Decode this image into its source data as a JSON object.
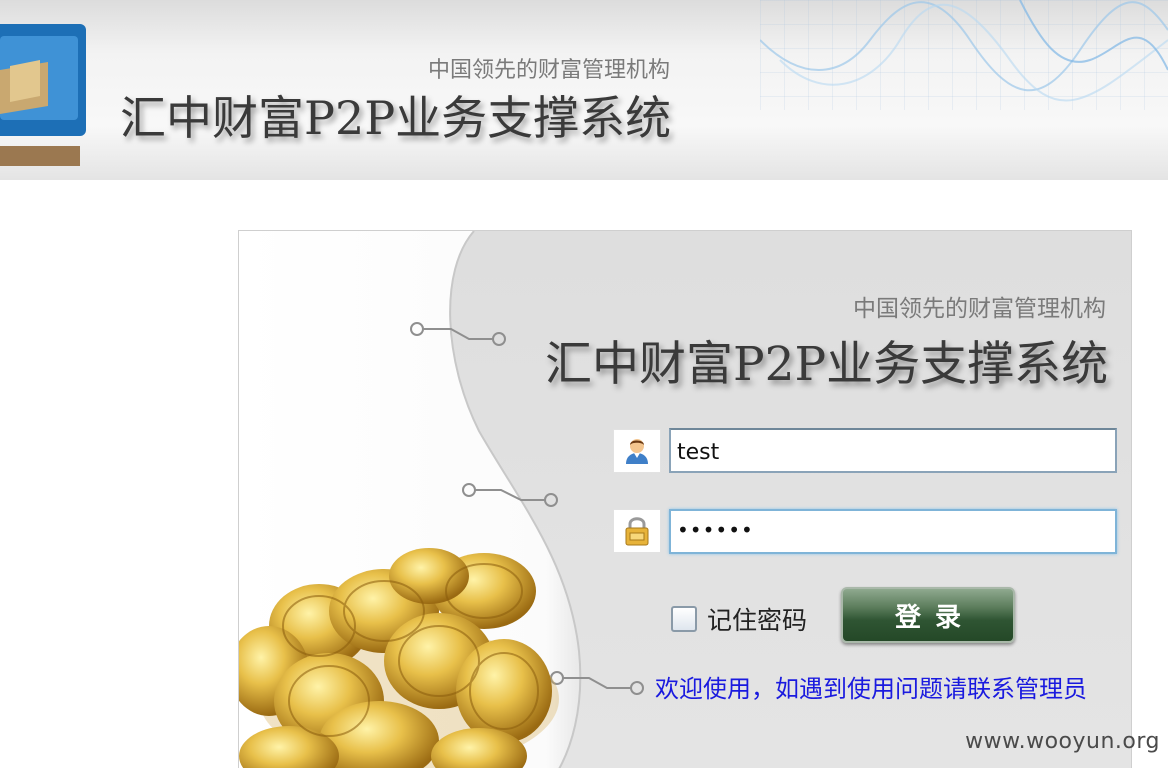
{
  "header": {
    "subtitle": "中国领先的财富管理机构",
    "title": "汇中财富P2P业务支撑系统"
  },
  "login": {
    "subtitle": "中国领先的财富管理机构",
    "title": "汇中财富P2P业务支撑系统",
    "username_value": "test",
    "password_value": "••••••",
    "remember_label": "记住密码",
    "login_button": "登录",
    "welcome_text": "欢迎使用，如遇到使用问题请联系管理员"
  },
  "watermark": "www.wooyun.org",
  "colors": {
    "welcome_link": "#1a1adf",
    "button_green": "#2f5533",
    "input_border": "#8aa3b8"
  },
  "icons": {
    "username": "user-icon",
    "password": "lock-icon",
    "logo": "logo-icon",
    "coins": "gold-coins-image"
  }
}
